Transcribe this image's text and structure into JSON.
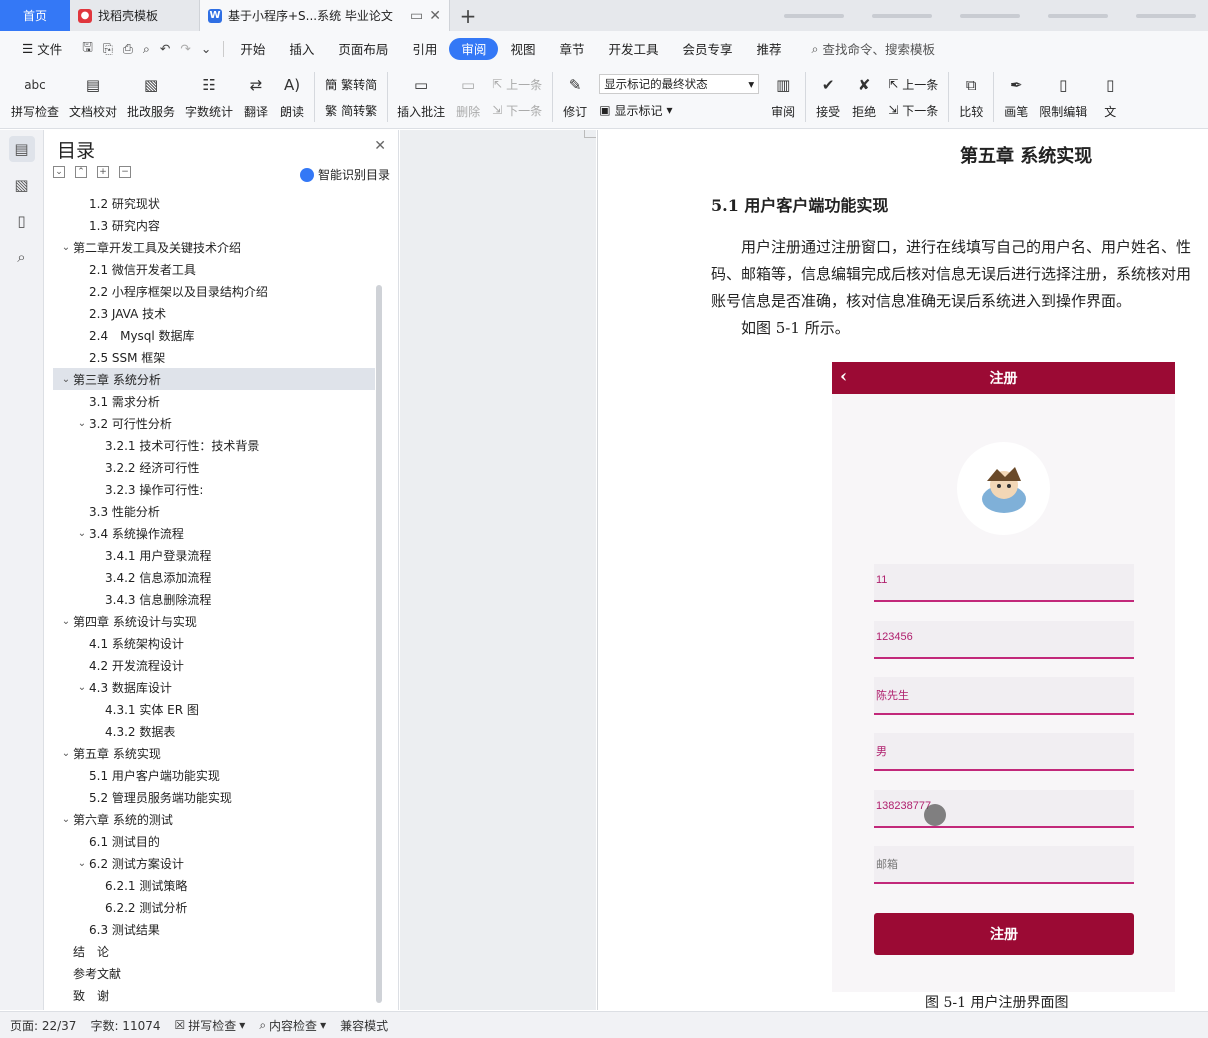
{
  "tabs": {
    "home": "首页",
    "template": "找稻壳模板",
    "doc": "基于小程序+S...系统 毕业论文",
    "add": "+"
  },
  "menu": {
    "file": "文件",
    "items": [
      "开始",
      "插入",
      "页面布局",
      "引用",
      "审阅",
      "视图",
      "章节",
      "开发工具",
      "会员专享",
      "推荐"
    ],
    "active": "审阅",
    "search": "查找命令、搜索模板"
  },
  "ribbon": {
    "spellcheck": "拼写检查",
    "doc_check": "文档校对",
    "batch_service": "批改服务",
    "word_count": "字数统计",
    "translate": "翻译",
    "read_aloud": "朗读",
    "trad": "繁转简",
    "simp": "简转繁",
    "insert_comment": "插入批注",
    "delete": "删除",
    "prev": "上一条",
    "next": "下一条",
    "revise": "修订",
    "markup_state": "显示标记的最终状态",
    "show_markup": "显示标记",
    "review": "审阅",
    "accept": "接受",
    "reject": "拒绝",
    "prev2": "上一条",
    "next2": "下一条",
    "compare": "比较",
    "pen": "画笔",
    "restrict": "限制编辑",
    "more": "文"
  },
  "toc": {
    "title": "目录",
    "smart": "智能识别目录",
    "items": [
      {
        "label": "1.2 研究现状",
        "level": 2,
        "caret": ""
      },
      {
        "label": "1.3 研究内容",
        "level": 2,
        "caret": ""
      },
      {
        "label": "第二章开发工具及关键技术介绍",
        "level": 1,
        "caret": "v"
      },
      {
        "label": "2.1 微信开发者工具",
        "level": 2,
        "caret": ""
      },
      {
        "label": "2.2 小程序框架以及目录结构介绍",
        "level": 2,
        "caret": ""
      },
      {
        "label": "2.3 JAVA 技术",
        "level": 2,
        "caret": ""
      },
      {
        "label": "2.4　Mysql 数据库",
        "level": 2,
        "caret": ""
      },
      {
        "label": "2.5 SSM 框架",
        "level": 2,
        "caret": ""
      },
      {
        "label": "第三章  系统分析",
        "level": 1,
        "caret": "v",
        "selected": true
      },
      {
        "label": "3.1 需求分析",
        "level": 2,
        "caret": ""
      },
      {
        "label": "3.2 可行性分析",
        "level": 2,
        "caret": "v"
      },
      {
        "label": "3.2.1 技术可行性：技术背景",
        "level": 3,
        "caret": ""
      },
      {
        "label": "3.2.2 经济可行性",
        "level": 3,
        "caret": ""
      },
      {
        "label": "3.2.3 操作可行性:",
        "level": 3,
        "caret": ""
      },
      {
        "label": "3.3 性能分析",
        "level": 2,
        "caret": ""
      },
      {
        "label": "3.4 系统操作流程",
        "level": 2,
        "caret": "v"
      },
      {
        "label": "3.4.1 用户登录流程",
        "level": 3,
        "caret": ""
      },
      {
        "label": "3.4.2 信息添加流程",
        "level": 3,
        "caret": ""
      },
      {
        "label": "3.4.3 信息删除流程",
        "level": 3,
        "caret": ""
      },
      {
        "label": "第四章  系统设计与实现",
        "level": 1,
        "caret": "v"
      },
      {
        "label": "4.1 系统架构设计",
        "level": 2,
        "caret": ""
      },
      {
        "label": "4.2 开发流程设计",
        "level": 2,
        "caret": ""
      },
      {
        "label": "4.3 数据库设计",
        "level": 2,
        "caret": "v"
      },
      {
        "label": "4.3.1 实体 ER 图",
        "level": 3,
        "caret": ""
      },
      {
        "label": "4.3.2 数据表",
        "level": 3,
        "caret": ""
      },
      {
        "label": "第五章  系统实现",
        "level": 1,
        "caret": "v"
      },
      {
        "label": "5.1 用户客户端功能实现",
        "level": 2,
        "caret": ""
      },
      {
        "label": "5.2  管理员服务端功能实现",
        "level": 2,
        "caret": ""
      },
      {
        "label": "第六章    系统的测试",
        "level": 1,
        "caret": "v"
      },
      {
        "label": "6.1  测试目的",
        "level": 2,
        "caret": ""
      },
      {
        "label": "6.2  测试方案设计",
        "level": 2,
        "caret": "v"
      },
      {
        "label": "6.2.1  测试策略",
        "level": 3,
        "caret": ""
      },
      {
        "label": "6.2.2  测试分析",
        "level": 3,
        "caret": ""
      },
      {
        "label": "6.3  测试结果",
        "level": 2,
        "caret": ""
      },
      {
        "label": "结　论",
        "level": 1,
        "caret": ""
      },
      {
        "label": "参考文献",
        "level": 1,
        "caret": ""
      },
      {
        "label": "致　谢",
        "level": 1,
        "caret": ""
      }
    ]
  },
  "doc": {
    "chapter_title": "第五章  系统实现",
    "section_title": "5.1 用户客户端功能实现",
    "para_lines": [
      "用户注册通过注册窗口，进行在线填写自己的用户名、用户姓名、性",
      "码、邮箱等，信息编辑完成后核对信息无误后进行选择注册，系统核对用",
      "账号信息是否准确，核对信息准确无误后系统进入到操作界面。",
      "如图 5-1 所示。"
    ],
    "figure": {
      "bar_title": "注册",
      "fields": [
        "11",
        "123456",
        "陈先生",
        "男",
        "138238777",
        "邮箱"
      ],
      "button": "注册"
    },
    "caption": "图 5-1 用户注册界面图"
  },
  "status": {
    "page": "页面: 22/37",
    "words": "字数: 11074",
    "spell": "拼写检查",
    "content": "内容检查",
    "compat": "兼容模式"
  },
  "colors": {
    "accent": "#3478f6",
    "figure_bar": "#9b0a34",
    "field_line": "#c2287a"
  }
}
